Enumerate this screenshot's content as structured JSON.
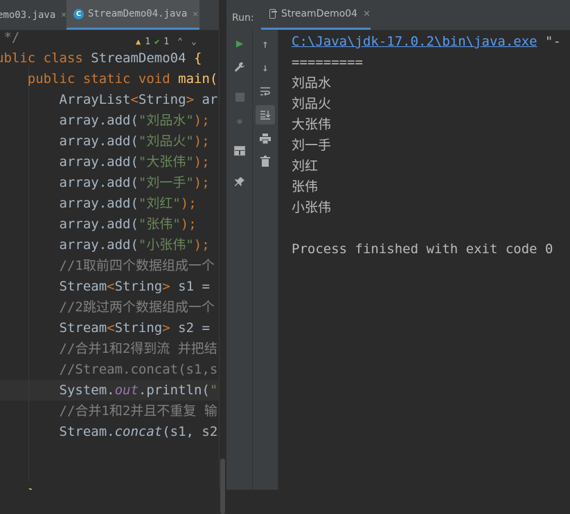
{
  "editor": {
    "tabs": [
      {
        "label": "emo03.java",
        "active": false
      },
      {
        "label": "StreamDemo04.java",
        "active": true
      }
    ],
    "inspection": {
      "warnings": "1",
      "checks": "1"
    },
    "code": [
      {
        "parts": [
          [
            "cmt",
            " */"
          ]
        ]
      },
      {
        "parts": [
          [
            "kw",
            "ublic "
          ],
          [
            "kw",
            "class "
          ],
          [
            "cls",
            "StreamDemo04 "
          ],
          [
            "fn",
            "{"
          ]
        ]
      },
      {
        "parts": [
          [
            "kw",
            "    public "
          ],
          [
            "kw",
            "static "
          ],
          [
            "kw",
            "void "
          ],
          [
            "fn",
            "main("
          ]
        ]
      },
      {
        "parts": [
          [
            "cls",
            "        ArrayList"
          ],
          [
            "gen",
            "<"
          ],
          [
            "cls",
            "String"
          ],
          [
            "gen",
            ">"
          ],
          [
            "cls",
            " ar"
          ]
        ]
      },
      {
        "parts": [
          [
            "cls",
            "        array.add("
          ],
          [
            "str",
            "\"刘品水\""
          ],
          [
            "kw",
            ");"
          ]
        ]
      },
      {
        "parts": [
          [
            "cls",
            "        array.add("
          ],
          [
            "str",
            "\"刘品火\""
          ],
          [
            "kw",
            ");"
          ]
        ]
      },
      {
        "parts": [
          [
            "cls",
            "        array.add("
          ],
          [
            "str",
            "\"大张伟\""
          ],
          [
            "kw",
            ");"
          ]
        ]
      },
      {
        "parts": [
          [
            "cls",
            "        array.add("
          ],
          [
            "str",
            "\"刘一手\""
          ],
          [
            "kw",
            ");"
          ]
        ]
      },
      {
        "parts": [
          [
            "cls",
            "        array.add("
          ],
          [
            "str",
            "\"刘红\""
          ],
          [
            "kw",
            ");"
          ]
        ]
      },
      {
        "parts": [
          [
            "cls",
            "        array.add("
          ],
          [
            "str",
            "\"张伟\""
          ],
          [
            "kw",
            ");"
          ]
        ]
      },
      {
        "parts": [
          [
            "cls",
            "        array.add("
          ],
          [
            "str",
            "\"小张伟\""
          ],
          [
            "kw",
            ");"
          ]
        ]
      },
      {
        "parts": [
          [
            "cmt",
            "        //1取前四个数据组成一个"
          ]
        ]
      },
      {
        "parts": [
          [
            "cls",
            "        Stream"
          ],
          [
            "gen",
            "<"
          ],
          [
            "cls",
            "String"
          ],
          [
            "gen",
            ">"
          ],
          [
            "cls",
            " s1 ="
          ]
        ]
      },
      {
        "parts": [
          [
            "cmt",
            "        //2跳过两个数据组成一个"
          ]
        ]
      },
      {
        "parts": [
          [
            "cls",
            "        Stream"
          ],
          [
            "gen",
            "<"
          ],
          [
            "cls",
            "String"
          ],
          [
            "gen",
            ">"
          ],
          [
            "cls",
            " s2 ="
          ]
        ]
      },
      {
        "parts": [
          [
            "cmt",
            "        //合并1和2得到流 并把结"
          ]
        ]
      },
      {
        "parts": [
          [
            "cmt",
            "        //Stream.concat(s1,s"
          ]
        ]
      },
      {
        "parts": [
          [
            "cls",
            "        System."
          ],
          [
            "ital",
            "out"
          ],
          [
            "cls",
            ".println("
          ],
          [
            "str",
            "\""
          ]
        ]
      },
      {
        "parts": [
          [
            "cmt",
            "        //合并1和2并且不重复 输"
          ]
        ]
      },
      {
        "parts": [
          [
            "cls",
            "        Stream."
          ],
          [
            "ital2",
            "concat"
          ],
          [
            "cls",
            "(s1, s2"
          ]
        ]
      },
      {
        "parts": [
          [
            "cls",
            ""
          ]
        ]
      },
      {
        "parts": [
          [
            "cls",
            ""
          ]
        ]
      },
      {
        "parts": [
          [
            "fn",
            "    }"
          ]
        ]
      }
    ]
  },
  "run": {
    "label": "Run:",
    "tab_label": "StreamDemo04",
    "console": [
      {
        "text": "C:\\Java\\jdk-17.0.2\\bin\\java.exe",
        "link": true,
        "suffix": " \"-"
      },
      {
        "text": "========="
      },
      {
        "text": "刘品水",
        "cn": true
      },
      {
        "text": "刘品火",
        "cn": true
      },
      {
        "text": "大张伟",
        "cn": true
      },
      {
        "text": "刘一手",
        "cn": true
      },
      {
        "text": "刘红",
        "cn": true
      },
      {
        "text": "张伟",
        "cn": true
      },
      {
        "text": "小张伟",
        "cn": true
      },
      {
        "text": ""
      },
      {
        "text": "Process finished with exit code 0"
      }
    ],
    "toolbar_left": [
      "run-icon",
      "wrench-icon",
      "stop-icon",
      "debug-icon",
      "layout-icon",
      "pin-icon"
    ],
    "toolbar_right": [
      "arrow-up-icon",
      "arrow-down-icon",
      "soft-wrap-icon",
      "scroll-to-end-icon",
      "print-icon",
      "trash-icon"
    ]
  },
  "colors": {
    "background": "#2b2b2b",
    "panel": "#3c3f41",
    "keyword": "#cc7832",
    "string": "#6a8759",
    "comment": "#808080",
    "link": "#589df6",
    "run_green": "#499c54"
  }
}
